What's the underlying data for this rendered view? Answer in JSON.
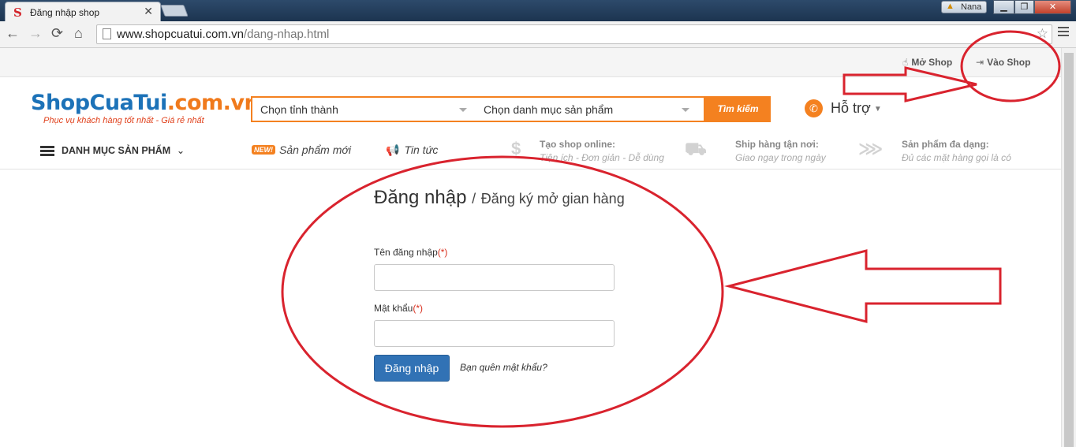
{
  "browser": {
    "tab_title": "Đăng nhập shop",
    "tab_close": "✕",
    "url_host": "www.shopcuatui.com.vn",
    "url_path": "/dang-nhap.html",
    "user_name": "Nana",
    "icons": [
      "back-icon",
      "forward-icon",
      "reload-icon",
      "home-icon",
      "page-icon",
      "star-icon",
      "menu-icon"
    ]
  },
  "topbar": {
    "open_shop": "Mở Shop",
    "enter_shop": "Vào Shop"
  },
  "header": {
    "logo_part1": "ShopCuaTui",
    "logo_part2": ".com.vn",
    "slogan": "Phục vụ khách hàng tốt nhất - Giá rẻ nhất",
    "province_select": "Chọn tỉnh thành",
    "category_select": "Chọn danh mục sản phẩm",
    "search_button": "Tìm kiếm",
    "support": "Hỗ trợ",
    "brand_color": "#f48120"
  },
  "nav": {
    "category_menu": "DANH MỤC SẢN PHẨM",
    "new_badge": "NEW!",
    "new_products": "Sản phẩm mới",
    "news": "Tin tức",
    "features": [
      {
        "title": "Tạo shop online:",
        "desc": "Tiện ích - Đơn giản - Dễ dùng"
      },
      {
        "title": "Ship hàng tận nơi:",
        "desc": "Giao ngay trong ngày"
      },
      {
        "title": "Sản phẩm đa dạng:",
        "desc": "Đủ các mặt hàng gọi là có"
      }
    ]
  },
  "login": {
    "title": "Đăng nhập",
    "separator": "/",
    "register_link": "Đăng ký mở gian hàng",
    "username_label": "Tên đăng nhập",
    "password_label": "Mật khẩu",
    "required_mark": "(*)",
    "username_value": "",
    "password_value": "",
    "submit": "Đăng nhập",
    "forgot": "Bạn quên mật khẩu?"
  },
  "annotation_color": "#d9232e"
}
